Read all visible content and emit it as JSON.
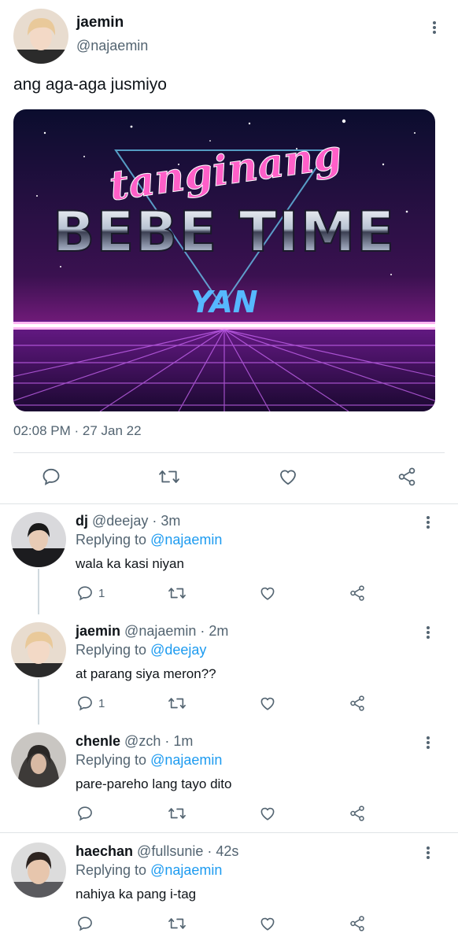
{
  "main_tweet": {
    "author_name": "jaemin",
    "author_handle": "@najaemin",
    "text": "ang aga-aga jusmiyo",
    "image": {
      "script_word": "tanginang",
      "chrome_words": "BEBE TIME",
      "bottom_word": "YAN"
    },
    "timestamp": "02:08 PM · 27 Jan 22",
    "icons": [
      "reply-icon",
      "retweet-icon",
      "like-icon",
      "share-icon"
    ]
  },
  "replies": [
    {
      "name": "dj",
      "meta": "@deejay · 3m",
      "replying_label": "Replying to",
      "mention": "@najaemin",
      "text": "wala ka kasi niyan",
      "reply_count": "1"
    },
    {
      "name": "jaemin",
      "meta": "@najaemin · 2m",
      "replying_label": "Replying to",
      "mention": "@deejay",
      "text": "at parang siya meron??",
      "reply_count": "1"
    },
    {
      "name": "chenle",
      "meta": "@zch · 1m",
      "replying_label": "Replying to",
      "mention": "@najaemin",
      "text": "pare-pareho lang tayo dito",
      "reply_count": ""
    },
    {
      "name": "haechan",
      "meta": "@fullsunie · 42s",
      "replying_label": "Replying to",
      "mention": "@najaemin",
      "text": "nahiya ka pang i-tag",
      "reply_count": ""
    }
  ],
  "colors": {
    "text_primary": "#0f1419",
    "text_secondary": "#536471",
    "link": "#1d9bf0",
    "divider": "#dfe3e6"
  }
}
